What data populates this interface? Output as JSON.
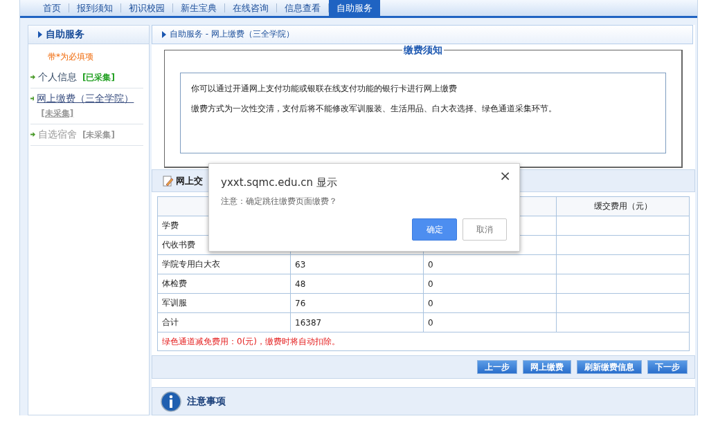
{
  "nav": [
    {
      "label": "首页",
      "selected": false
    },
    {
      "label": "报到须知",
      "selected": false
    },
    {
      "label": "初识校园",
      "selected": false
    },
    {
      "label": "新生宝典",
      "selected": false
    },
    {
      "label": "在线咨询",
      "selected": false
    },
    {
      "label": "信息查看",
      "selected": false
    },
    {
      "label": "自助服务",
      "selected": true
    }
  ],
  "sidebar": {
    "title": "自助服务",
    "note": "带*为必填项",
    "items": [
      {
        "label": "个人信息",
        "status": "[已采集]",
        "collected": true,
        "selected": false,
        "disabled": false
      },
      {
        "label": "网上缴费（三全学院）",
        "status": "[未采集]",
        "collected": false,
        "selected": true,
        "disabled": false
      },
      {
        "label": "自选宿舍",
        "status": "[未采集]",
        "collected": false,
        "selected": false,
        "disabled": true
      }
    ]
  },
  "breadcrumb": "自助服务 - 网上缴费（三全学院）",
  "notice": {
    "title": "缴费须知",
    "lines": [
      "你可以通过开通网上支付功能或银联在线支付功能的银行卡进行网上缴费",
      "缴费方式为一次性交清，支付后将不能修改军训服装、生活用品、白大衣选择、绿色通道采集环节。"
    ]
  },
  "payment": {
    "title": "网上交",
    "column_4_header": "缓交费用（元）",
    "rows": [
      {
        "name": "学费"
      },
      {
        "name": "代收书费"
      },
      {
        "name": "学院专用白大衣",
        "column_2": "63",
        "column_3": "0"
      },
      {
        "name": "体检费",
        "column_2": "48",
        "column_3": "0"
      },
      {
        "name": "军训服",
        "column_2": "76",
        "column_3": "0"
      },
      {
        "name": "合计",
        "column_2": "16387",
        "column_3": "0"
      }
    ],
    "footnote": "绿色通道减免费用：0(元)，缴费时将自动扣除。",
    "buttons": [
      "上一步",
      "网上缴费",
      "刷新缴费信息",
      "下一步"
    ]
  },
  "notes_title": "注意事项",
  "dialog": {
    "title": "yxxt.sqmc.edu.cn 显示",
    "message": "注意：确定跳往缴费页面缴费？",
    "close": "×",
    "ok": "确定",
    "cancel": "取消"
  }
}
